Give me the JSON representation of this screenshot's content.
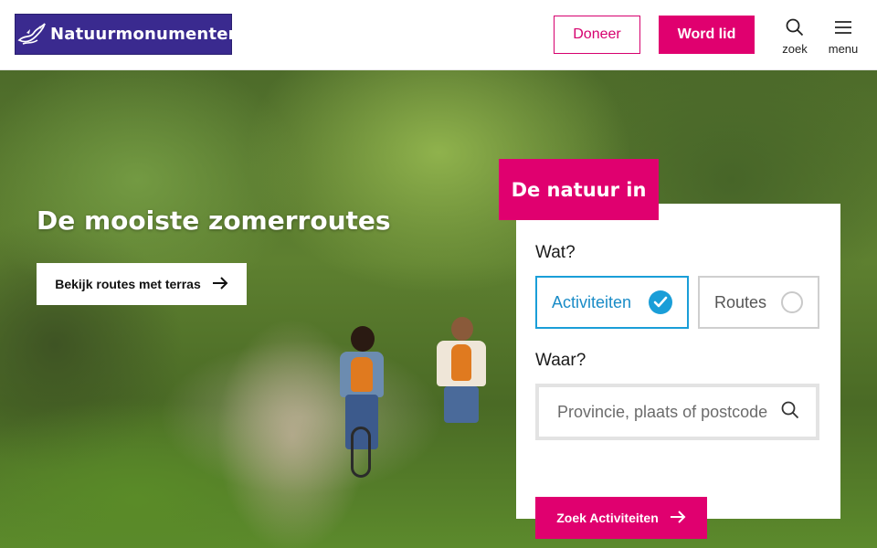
{
  "header": {
    "logo_text": "Natuurmonumenten",
    "doneer_label": "Doneer",
    "word_lid_label": "Word lid",
    "zoek_label": "zoek",
    "menu_label": "menu"
  },
  "hero": {
    "title": "De mooiste zomerroutes",
    "cta_label": "Bekijk routes met terras"
  },
  "search_card": {
    "tab_title": "De natuur in",
    "wat_label": "Wat?",
    "options": [
      {
        "label": "Activiteiten",
        "selected": true
      },
      {
        "label": "Routes",
        "selected": false
      }
    ],
    "waar_label": "Waar?",
    "location_placeholder": "Provincie, plaats of postcode",
    "submit_label": "Zoek Activiteiten"
  },
  "colors": {
    "brand_purple": "#3a2a8f",
    "accent_pink": "#e0006f",
    "selected_blue": "#1a9ed8"
  },
  "icons": [
    "logo-bird-icon",
    "search-icon",
    "hamburger-menu-icon",
    "arrow-right-icon",
    "check-circle-icon",
    "radio-empty-icon"
  ]
}
